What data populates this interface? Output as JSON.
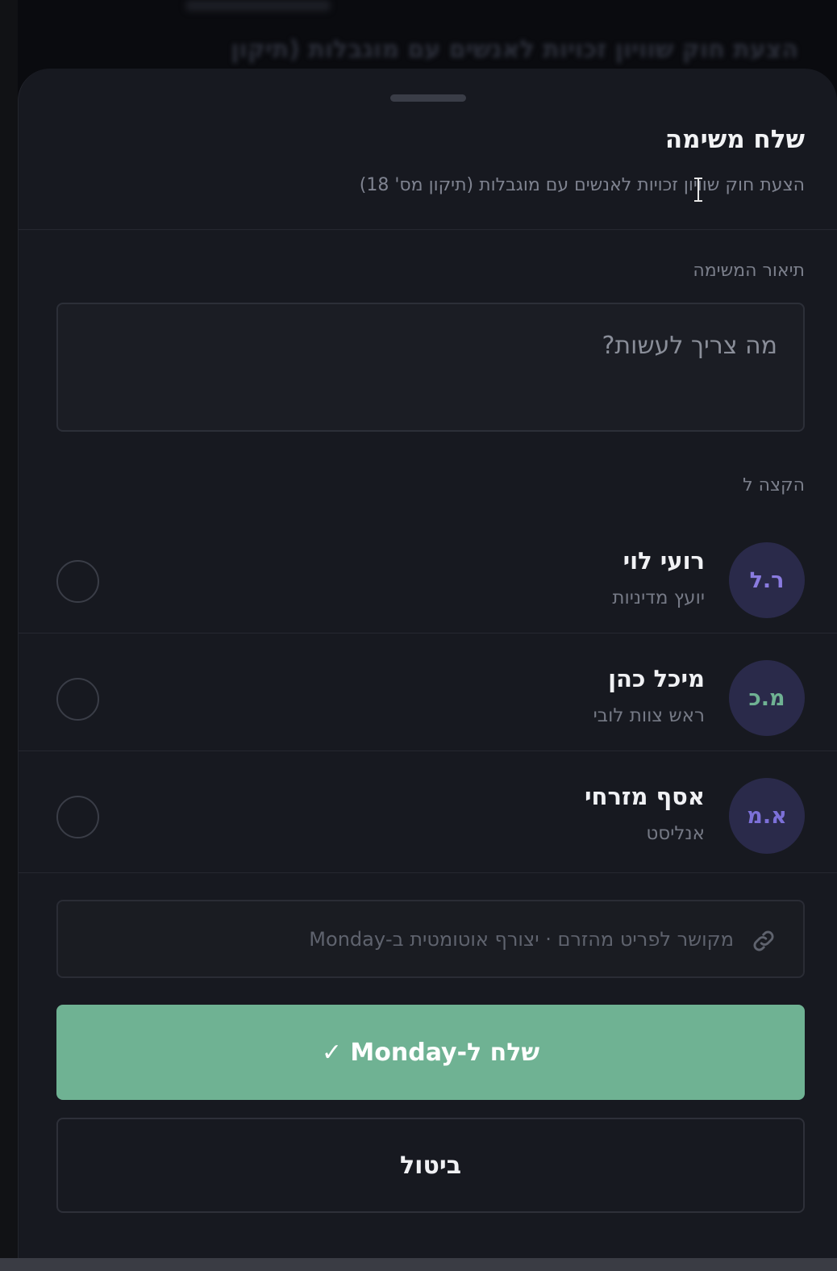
{
  "background": {
    "header_text": "הצעת חוק שוויון זכויות לאנשים עם מוגבלות (תיקון"
  },
  "sheet": {
    "title": "שלח משימה",
    "subtitle": "הצעת חוק שוויון זכויות לאנשים עם מוגבלות (תיקון מס' 18)"
  },
  "task": {
    "label": "תיאור המשימה",
    "placeholder": "מה צריך לעשות?"
  },
  "assign": {
    "label": "הקצה ל",
    "people": [
      {
        "initials": "ר.ל",
        "name": "רועי לוי",
        "role": "יועץ מדיניות",
        "color": "#8a7be0"
      },
      {
        "initials": "מ.כ",
        "name": "מיכל כהן",
        "role": "ראש צוות לובי",
        "color": "#6fb293"
      },
      {
        "initials": "א.מ",
        "name": "אסף מזרחי",
        "role": "אנליסט",
        "color": "#7c70d8"
      }
    ]
  },
  "link_note": {
    "icon": "link-icon",
    "text": "מקושר לפריט מהזרם · יצורף אוטומטית ב-Monday"
  },
  "actions": {
    "send_label": "שלח ל-Monday ✓",
    "cancel_label": "ביטול"
  },
  "colors": {
    "accent": "#6fb293",
    "sheet_bg": "#171920",
    "avatar_bg": "#2a2a4a"
  }
}
